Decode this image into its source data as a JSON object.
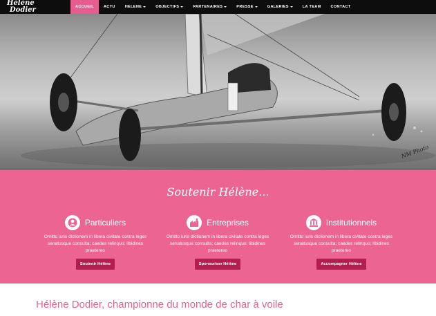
{
  "logo": {
    "line1": "Hélène",
    "line2": "Dodier"
  },
  "nav": [
    {
      "label": "ACCUEIL",
      "dropdown": false,
      "active": true
    },
    {
      "label": "ACTU",
      "dropdown": false
    },
    {
      "label": "HELENE",
      "dropdown": true
    },
    {
      "label": "OBJECTIFS",
      "dropdown": true
    },
    {
      "label": "PARTENAIRES",
      "dropdown": true
    },
    {
      "label": "PRESSE",
      "dropdown": true
    },
    {
      "label": "GALERIES",
      "dropdown": true
    },
    {
      "label": "LA TEAM",
      "dropdown": false
    },
    {
      "label": "CONTACT",
      "dropdown": false
    }
  ],
  "hero": {
    "photo_credit": "NM Photo"
  },
  "support": {
    "title": "Soutenir Hélène...",
    "columns": [
      {
        "icon": "person-icon",
        "title": "Particuliers",
        "text": "Omitto iuris dictionem in libera civitate contra leges senatusque consulta; caedes relinquo; libidines praetereo",
        "button": "Soutenir Hélène"
      },
      {
        "icon": "factory-icon",
        "title": "Entreprises",
        "text": "Omitto iuris dictionem in libera civitate contra leges senatusque consulta; caedes relinquo; libidines praetereo",
        "button": "Sponsoriser Hélène"
      },
      {
        "icon": "institution-icon",
        "title": "Institutionnels",
        "text": "Omitto iuris dictionem in libera civitate contra leges senatusque consulta; caedes relinquo; libidines praetereo",
        "button": "Accompagner Hélène"
      }
    ]
  },
  "headline": "Hélène Dodier, championne du monde de char à voile",
  "colors": {
    "pink": "#ec6492",
    "button": "#b11e4f",
    "nav_bg": "#0d0d0d",
    "headline": "#e26391"
  }
}
